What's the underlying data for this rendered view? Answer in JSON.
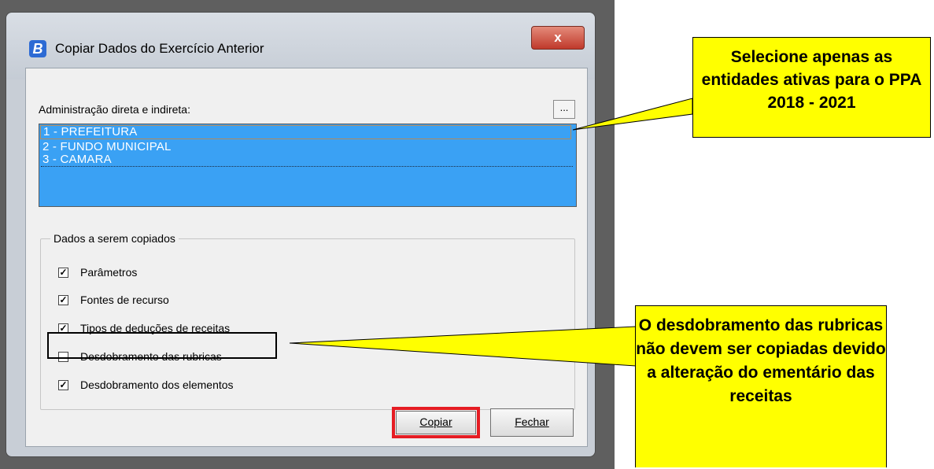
{
  "window": {
    "title": "Copiar Dados do Exercício Anterior",
    "app_icon": "B",
    "close_label": "x"
  },
  "admin": {
    "label": "Administração direta e indireta:",
    "browse_label": "..."
  },
  "entities": [
    {
      "label": "1 - PREFEITURA"
    },
    {
      "label": "2 - FUNDO MUNICIPAL"
    },
    {
      "label": "3 - CAMARA"
    }
  ],
  "group": {
    "title": "Dados a serem copiados",
    "options": [
      {
        "label": "Parâmetros",
        "checked": true
      },
      {
        "label": "Fontes de recurso",
        "checked": true
      },
      {
        "label": "Tipos de deduções de receitas",
        "checked": true
      },
      {
        "label": "Desdobramento das rubricas",
        "checked": false
      },
      {
        "label": "Desdobramento dos elementos",
        "checked": true
      }
    ]
  },
  "buttons": {
    "copy_label": "Copiar",
    "close_label": "Fechar"
  },
  "callouts": {
    "entities_note": "Selecione apenas as entidades ativas para o PPA 2018 - 2021",
    "rubricas_note": "O desdobramento das rubricas não devem ser copiadas devido a alteração do ementário das receitas"
  },
  "colors": {
    "list_selection": "#3aa1f4",
    "callout": "#ffff00",
    "highlight_red": "#e51c23",
    "close_button": "#c0392b"
  }
}
